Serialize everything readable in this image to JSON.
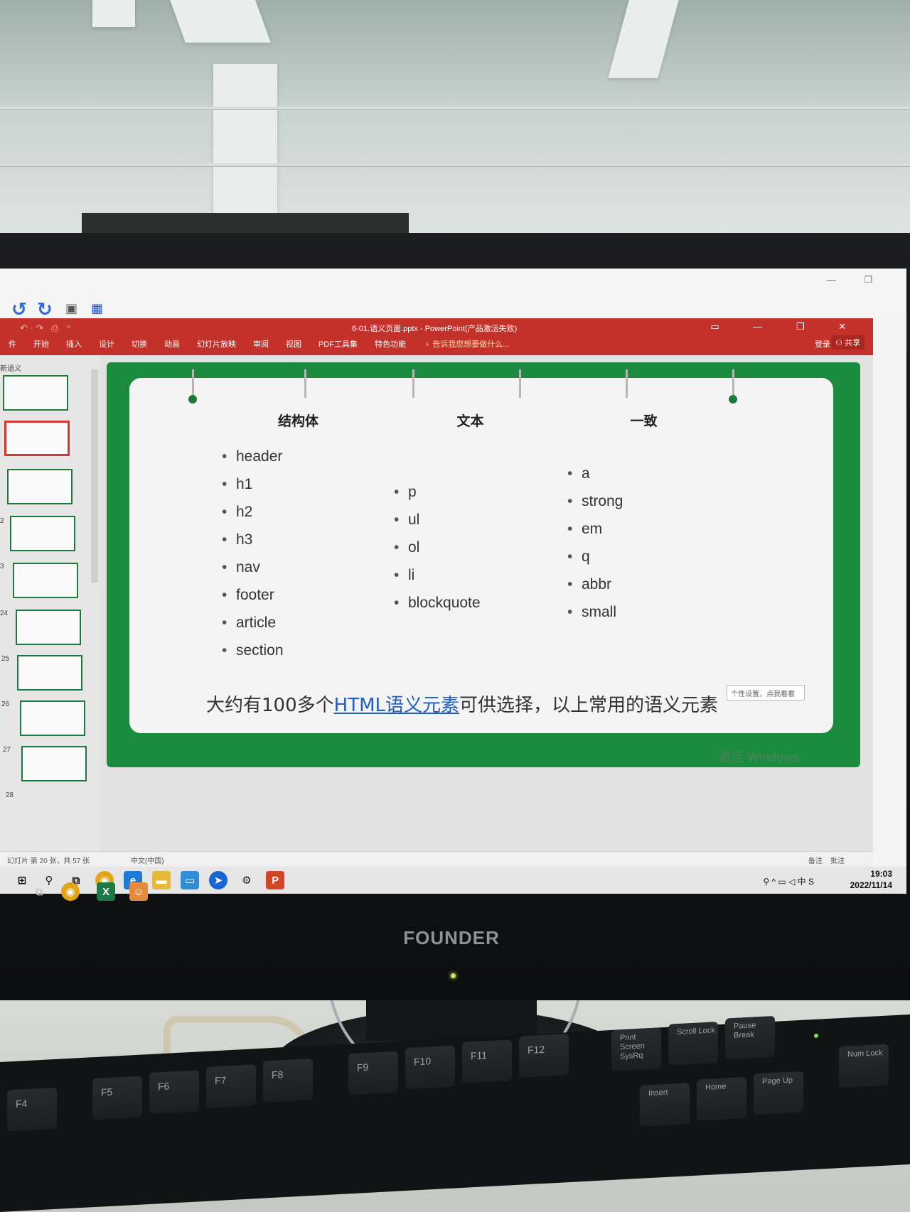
{
  "window": {
    "doc_title": "6-01.语义页面.pptx - PowerPoint(产品激活失败)",
    "signin": "登录",
    "share": "共享",
    "winctl": "▭ — ❐ ✕",
    "outer_winctl": "— ❐"
  },
  "ribbon": {
    "tabs": [
      "件",
      "开始",
      "插入",
      "设计",
      "切换",
      "动画",
      "幻灯片放映",
      "审阅",
      "视图",
      "PDF工具集",
      "特色功能"
    ],
    "tellme": "告诉我您想要做什么..."
  },
  "thumbnails": {
    "section_label": "新语义",
    "items": [
      {
        "num": ""
      },
      {
        "num": ""
      },
      {
        "num": ""
      },
      {
        "num": "2"
      },
      {
        "num": "3"
      },
      {
        "num": "24"
      },
      {
        "num": "25"
      },
      {
        "num": "26"
      },
      {
        "num": "27"
      },
      {
        "num": "28"
      }
    ]
  },
  "slide": {
    "columns": [
      {
        "heading": "结构体",
        "items": [
          "header",
          "h1",
          "h2",
          "h3",
          "nav",
          "footer",
          "article",
          "section"
        ]
      },
      {
        "heading": "文本",
        "items": [
          "p",
          "ul",
          "ol",
          "li",
          "blockquote"
        ]
      },
      {
        "heading": "一致",
        "items": [
          "a",
          "strong",
          "em",
          "q",
          "abbr",
          "small"
        ]
      }
    ],
    "caption_before": "大约有100多个",
    "caption_link": "HTML语义元素",
    "caption_after": "可供选择，以上常用的语义元素",
    "ime_popup": "个性设置，点我看看",
    "watermark": "激活 Windows"
  },
  "statusbar": {
    "slide_info": "幻灯片 第 20 张，共 57 张",
    "language": "中文(中国)",
    "notes": "备注",
    "comments": "批注"
  },
  "taskbar": {
    "time": "19:03",
    "date": "2022/11/14",
    "ime": "中"
  },
  "monitor": {
    "brand": "FOUNDER"
  },
  "keyboard": {
    "keys": [
      "F4",
      "F5",
      "F6",
      "F7",
      "F8",
      "F9",
      "F10",
      "F11",
      "F12",
      "Print Screen SysRq",
      "Scroll Lock",
      "Pause Break",
      "Num Lock",
      "Insert",
      "Home",
      "Page Up"
    ]
  }
}
